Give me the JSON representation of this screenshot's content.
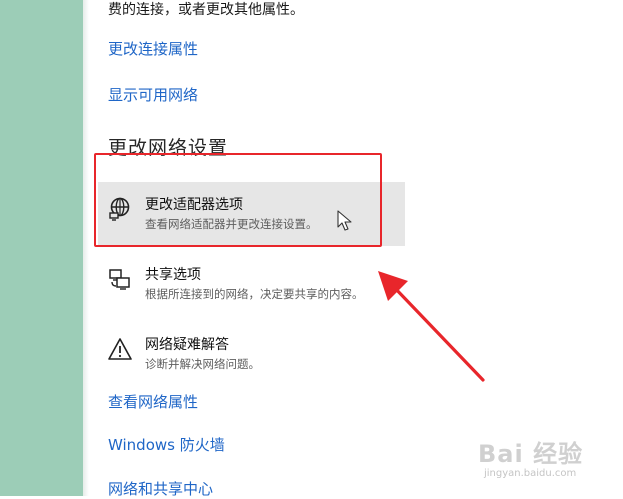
{
  "top_text": "费的连接，或者更改其他属性。",
  "links_top": {
    "change_connection_properties": "更改连接属性",
    "show_available_networks": "显示可用网络"
  },
  "section": {
    "title": "更改网络设置"
  },
  "settings": {
    "adapter": {
      "title": "更改适配器选项",
      "subtitle": "查看网络适配器并更改连接设置。",
      "icon": "network-adapter-icon"
    },
    "sharing": {
      "title": "共享选项",
      "subtitle": "根据所连接到的网络，决定要共享的内容。",
      "icon": "sharing-icon"
    },
    "troubleshoot": {
      "title": "网络疑难解答",
      "subtitle": "诊断并解决网络问题。",
      "icon": "warning-icon"
    }
  },
  "links_bottom": {
    "view_network_properties": "查看网络属性",
    "windows_firewall": "Windows 防火墙",
    "network_sharing_center": "网络和共享中心"
  },
  "watermark": {
    "main": "Bai 经验",
    "sub": "jingyan.baidu.com"
  },
  "colors": {
    "left_strip": "#9ccdb7",
    "link": "#1f66c7",
    "annotation_red": "#e8262b",
    "hover_bg": "#e6e6e6"
  }
}
